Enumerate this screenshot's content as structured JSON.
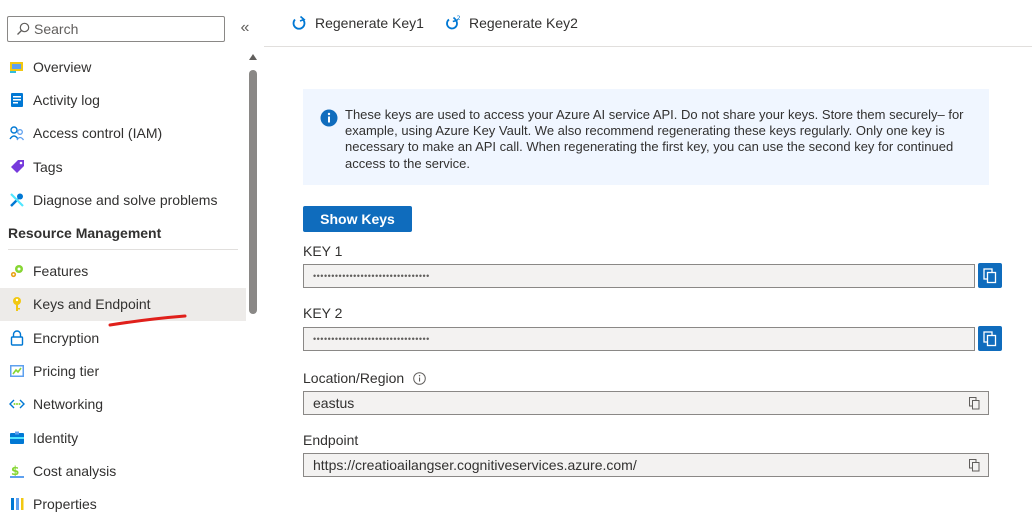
{
  "sidebar": {
    "search_placeholder": "Search",
    "collapse_label": "«",
    "items_top": [
      {
        "label": "Overview",
        "icon": "overview-icon"
      },
      {
        "label": "Activity log",
        "icon": "activity-log-icon"
      },
      {
        "label": "Access control (IAM)",
        "icon": "iam-icon"
      },
      {
        "label": "Tags",
        "icon": "tag-icon"
      },
      {
        "label": "Diagnose and solve problems",
        "icon": "wrench-icon"
      }
    ],
    "section_title": "Resource Management",
    "items_resource": [
      {
        "label": "Features",
        "icon": "features-icon"
      },
      {
        "label": "Keys and Endpoint",
        "icon": "key-icon",
        "active": true
      },
      {
        "label": "Encryption",
        "icon": "lock-icon"
      },
      {
        "label": "Pricing tier",
        "icon": "pricing-icon"
      },
      {
        "label": "Networking",
        "icon": "networking-icon"
      },
      {
        "label": "Identity",
        "icon": "identity-icon"
      },
      {
        "label": "Cost analysis",
        "icon": "cost-icon"
      },
      {
        "label": "Properties",
        "icon": "properties-icon"
      }
    ]
  },
  "toolbar": {
    "regen1_label": "Regenerate Key1",
    "regen2_label": "Regenerate Key2"
  },
  "info": {
    "text": "These keys are used to access your Azure AI service API. Do not share your keys. Store them securely– for example, using Azure Key Vault. We also recommend regenerating these keys regularly. Only one key is necessary to make an API call. When regenerating the first key, you can use the second key for continued access to the service."
  },
  "show_keys_label": "Show Keys",
  "fields": {
    "key1_label": "KEY 1",
    "key1_value": "••••••••••••••••••••••••••••••••",
    "key2_label": "KEY 2",
    "key2_value": "••••••••••••••••••••••••••••••••",
    "location_label": "Location/Region",
    "location_value": "eastus",
    "endpoint_label": "Endpoint",
    "endpoint_value": "https://creatioailangser.cognitiveservices.azure.com/"
  },
  "colors": {
    "accent": "#0f6cbd",
    "annotation": "#e0201b",
    "info_bg": "#f0f6ff",
    "active_bg": "#edebe9"
  }
}
